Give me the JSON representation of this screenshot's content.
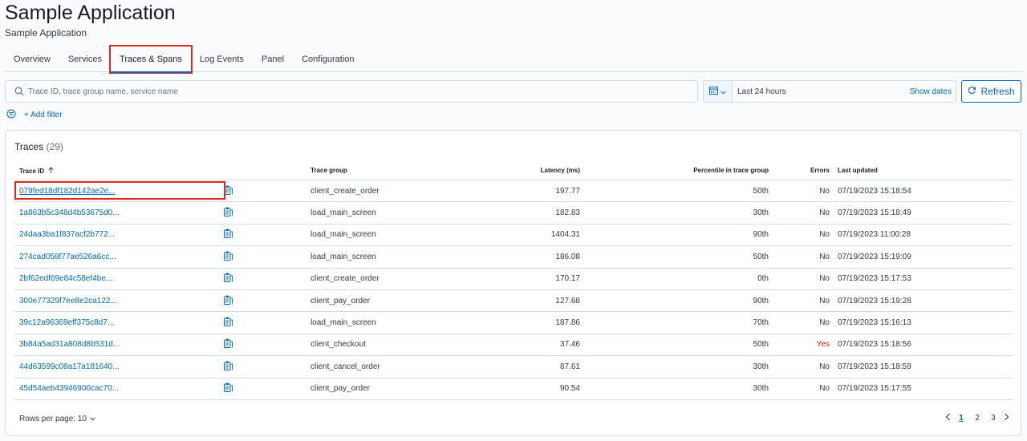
{
  "header": {
    "title": "Sample Application",
    "subtitle": "Sample Application"
  },
  "tabs": [
    {
      "label": "Overview"
    },
    {
      "label": "Services"
    },
    {
      "label": "Traces & Spans"
    },
    {
      "label": "Log Events"
    },
    {
      "label": "Panel"
    },
    {
      "label": "Configuration"
    }
  ],
  "search": {
    "placeholder": "Trace ID, trace group name, service name",
    "icon": "search-icon"
  },
  "datepicker": {
    "range": "Last 24 hours",
    "show_dates": "Show dates",
    "icon": "calendar-icon"
  },
  "refresh": {
    "label": "Refresh",
    "icon": "refresh-icon"
  },
  "filter": {
    "add_label": "+ Add filter",
    "icon": "filter-icon"
  },
  "traces": {
    "title": "Traces",
    "count": "(29)",
    "columns": {
      "trace_id": "Trace ID",
      "trace_group": "Trace group",
      "latency": "Latency (ms)",
      "percentile": "Percentile in trace group",
      "errors": "Errors",
      "last_updated": "Last updated"
    },
    "rows": [
      {
        "id": "079fed18df182d142ae2e...",
        "group": "client_create_order",
        "latency": "197.77",
        "percentile": "50th",
        "errors": "No",
        "updated": "07/19/2023 15:18:54"
      },
      {
        "id": "1a863b5c348d4b53675d0...",
        "group": "load_main_screen",
        "latency": "182.83",
        "percentile": "30th",
        "errors": "No",
        "updated": "07/19/2023 15:18:49"
      },
      {
        "id": "24daa3ba1f837acf2b772...",
        "group": "load_main_screen",
        "latency": "1404.31",
        "percentile": "90th",
        "errors": "No",
        "updated": "07/19/2023 11:00:28"
      },
      {
        "id": "274cad058f77ae526a6cc...",
        "group": "load_main_screen",
        "latency": "186.08",
        "percentile": "50th",
        "errors": "No",
        "updated": "07/19/2023 15:19:09"
      },
      {
        "id": "2bf62edf69e84c58ef4be...",
        "group": "client_create_order",
        "latency": "170.17",
        "percentile": "0th",
        "errors": "No",
        "updated": "07/19/2023 15:17:53"
      },
      {
        "id": "300e77329f7ee8e2ca122...",
        "group": "client_pay_order",
        "latency": "127.68",
        "percentile": "90th",
        "errors": "No",
        "updated": "07/19/2023 15:19:28"
      },
      {
        "id": "39c12a96369eff375c8d7...",
        "group": "load_main_screen",
        "latency": "187.86",
        "percentile": "70th",
        "errors": "No",
        "updated": "07/19/2023 15:16:13"
      },
      {
        "id": "3b84a5ad31a808d8b531d...",
        "group": "client_checkout",
        "latency": "37.46",
        "percentile": "50th",
        "errors": "Yes",
        "updated": "07/19/2023 15:18:56"
      },
      {
        "id": "44d63599c08a17a181640...",
        "group": "client_cancel_order",
        "latency": "87.61",
        "percentile": "30th",
        "errors": "No",
        "updated": "07/19/2023 15:18:59"
      },
      {
        "id": "45d54aeb43946900cac70...",
        "group": "client_pay_order",
        "latency": "90.54",
        "percentile": "30th",
        "errors": "No",
        "updated": "07/19/2023 15:17:55"
      }
    ]
  },
  "pagination": {
    "rows_per_page": "Rows per page: 10",
    "pages": [
      "1",
      "2",
      "3"
    ],
    "current": "1"
  },
  "colors": {
    "accent": "#006bb8",
    "highlight": "#e0291d",
    "error": "#bd271e"
  }
}
